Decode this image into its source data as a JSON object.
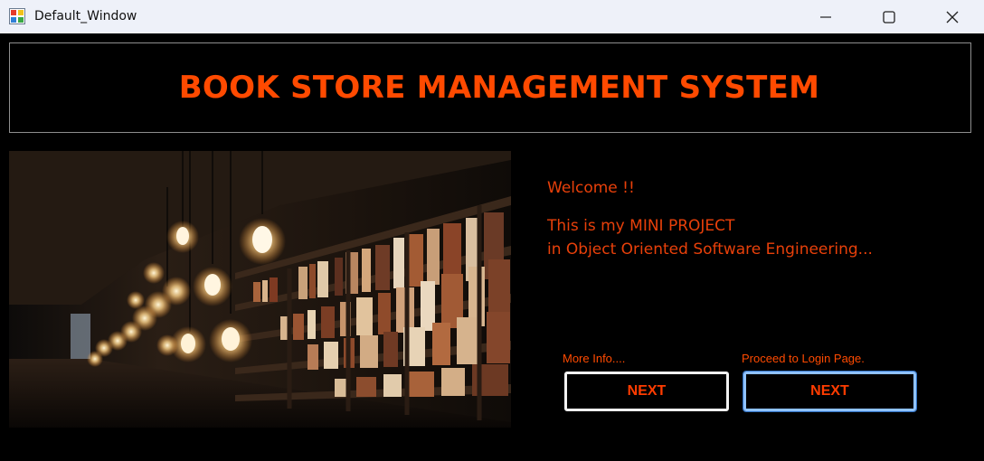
{
  "window": {
    "title": "Default_Window"
  },
  "header": {
    "title": "BOOK STORE MANAGEMENT SYSTEM"
  },
  "welcome": {
    "line1": "Welcome  !!",
    "line2": "This is my MINI PROJECT",
    "line3": "in Object Oriented Software Engineering..."
  },
  "actions": {
    "more_info_caption": "More Info....",
    "more_info_button": "NEXT",
    "login_caption": "Proceed to Login Page.",
    "login_button": "NEXT"
  },
  "image": {
    "subject": "library-bookshelves-with-hanging-bulbs-photo"
  },
  "colors": {
    "accent": "#ff4a00",
    "background": "#000000",
    "titlebar": "#eef1f9",
    "focus_border": "#8fc2ff"
  },
  "icons": {
    "app": "app-window-icon",
    "minimize": "minimize-icon",
    "maximize": "maximize-icon",
    "close": "close-icon"
  }
}
